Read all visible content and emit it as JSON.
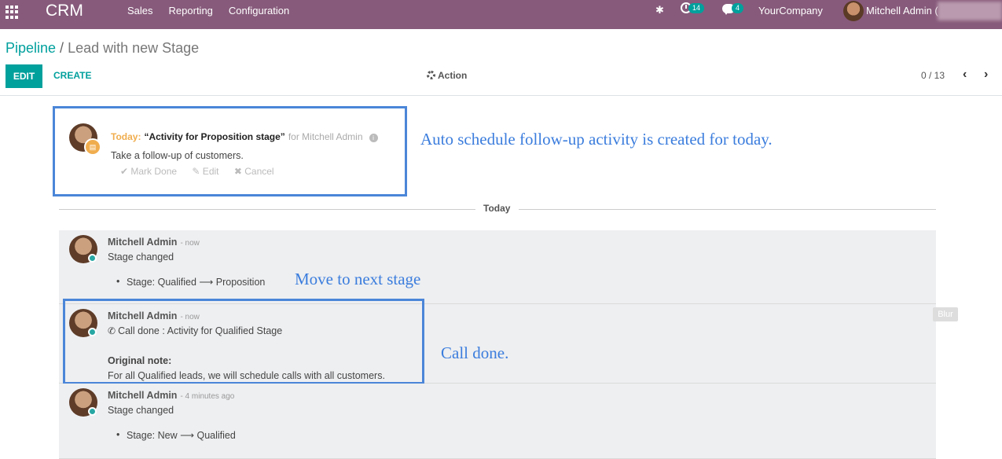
{
  "navbar": {
    "app_name": "CRM",
    "menu": [
      "Sales",
      "Reporting",
      "Configuration"
    ],
    "activity_count": "14",
    "message_count": "4",
    "company": "YourCompany",
    "user": "Mitchell Admin ("
  },
  "control_panel": {
    "breadcrumb_parent": "Pipeline",
    "breadcrumb_sep": "/",
    "breadcrumb_current": "Lead with new Stage",
    "edit_label": "EDIT",
    "create_label": "CREATE",
    "action_label": "Action",
    "pager": "0 / 13"
  },
  "activity": {
    "today_label": "Today:",
    "title": "“Activity for Proposition stage”",
    "for_user": "for Mitchell Admin",
    "note": "Take a follow-up of customers.",
    "mark_done": "✔ Mark Done",
    "edit": "✎ Edit",
    "cancel": "✖ Cancel"
  },
  "annotations": {
    "auto_schedule": "Auto schedule follow-up activity is created for today.",
    "move_stage": "Move to next stage",
    "call_done": "Call done."
  },
  "separator": "Today",
  "messages": [
    {
      "author": "Mitchell Admin",
      "time": "- now",
      "body": "Stage changed",
      "bullet": "Stage: Qualified ⟶ Proposition"
    },
    {
      "author": "Mitchell Admin",
      "time": "- now",
      "body": "Call done : Activity for Qualified Stage",
      "note_label": "Original note:",
      "note_text": "For all Qualified leads, we will schedule calls with all customers."
    },
    {
      "author": "Mitchell Admin",
      "time": "- 4 minutes ago",
      "body": "Stage changed",
      "bullet": "Stage: New ⟶ Qualified"
    }
  ],
  "blur_tag": "Blur",
  "colors": {
    "navbar": "#875a7b",
    "primary": "#00a09d",
    "annotation": "#3b7ddd",
    "today": "#f0ad4e"
  }
}
